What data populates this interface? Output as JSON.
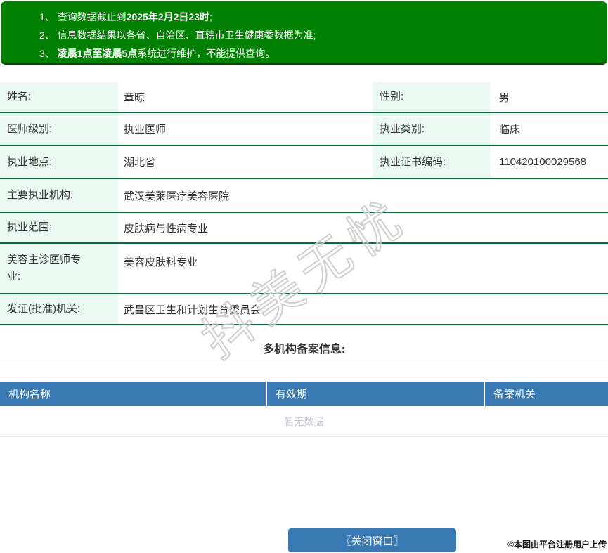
{
  "colors": {
    "banner_green": "#008000",
    "banner_edge": "#054d05",
    "label_cell_bg": "#e9f8f0",
    "row_divider_green": "#0a6b3a",
    "table_blue": "#3879b3",
    "empty_text_gray": "#c0c4cc"
  },
  "notices": {
    "items": [
      {
        "num": "1、 ",
        "pre": "查询数据截止到",
        "bold": "2025年2月2日23时",
        "post": ";"
      },
      {
        "num": "2、 ",
        "pre": "信息数据结果以各省、自治区、直辖市卫生健康委数据为准;",
        "bold": "",
        "post": ""
      },
      {
        "num": "3、 ",
        "pre": "",
        "bold": "凌晨1点至凌晨5点",
        "post": "系统进行维护，不能提供查询。"
      }
    ]
  },
  "profile": {
    "rows": [
      {
        "label1": "姓名:",
        "value1": "章晾",
        "label2": "性别:",
        "value2": "男"
      },
      {
        "label1": "医师级别:",
        "value1": "执业医师",
        "label2": "执业类别:",
        "value2": "临床"
      },
      {
        "label1": "执业地点:",
        "value1": "湖北省",
        "label2": "执业证书编码:",
        "value2": "110420100029568"
      },
      {
        "label1": "主要执业机构:",
        "value1": "武汉美莱医疗美容医院"
      },
      {
        "label1": "执业范围:",
        "value1": "皮肤病与性病专业"
      },
      {
        "label1": "美容主诊医师专业:",
        "value1": "美容皮肤科专业"
      },
      {
        "label1": "发证(批准)机关:",
        "value1": "武昌区卫生和计划生育委员会"
      }
    ]
  },
  "registration": {
    "title": "多机构备案信息:",
    "columns": [
      "机构名称",
      "有效期",
      "备案机关"
    ],
    "empty_text": "暂无数据"
  },
  "footer": {
    "close_button": "〖关闭窗口〗",
    "copyright": "©本图由平台注册用户上传"
  },
  "watermark": {
    "text": "抖美无忧"
  }
}
